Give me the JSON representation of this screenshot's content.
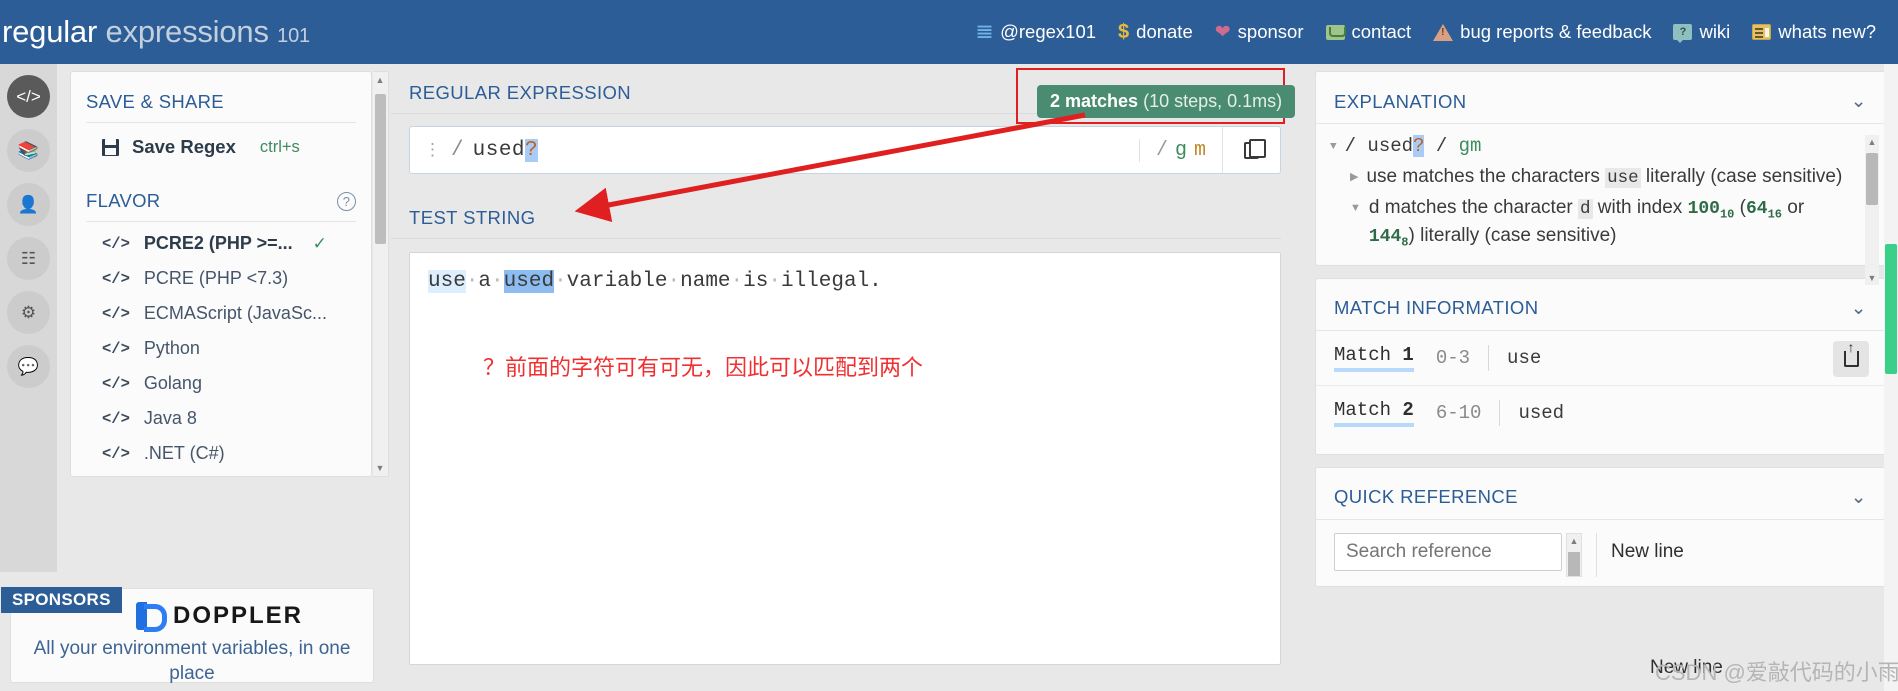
{
  "navbar": {
    "logo": {
      "part1": "regular",
      "part2": "expressions",
      "part3": "101"
    },
    "links": [
      {
        "label": "@regex101",
        "icon": "twitter-icon"
      },
      {
        "label": "donate",
        "icon": "dollar-icon"
      },
      {
        "label": "sponsor",
        "icon": "heart-icon"
      },
      {
        "label": "contact",
        "icon": "envelope-icon"
      },
      {
        "label": "bug reports & feedback",
        "icon": "warning-icon"
      },
      {
        "label": "wiki",
        "icon": "question-bubble-icon"
      },
      {
        "label": "whats new?",
        "icon": "newspaper-icon"
      }
    ]
  },
  "rail": {
    "items": [
      {
        "name": "code-icon",
        "glyph": "</>",
        "active": true
      },
      {
        "name": "library-icon",
        "glyph": "☰",
        "active": false
      },
      {
        "name": "account-icon",
        "glyph": "●",
        "active": false
      },
      {
        "name": "community-icon",
        "glyph": "⚙",
        "active": false
      },
      {
        "name": "settings-icon",
        "glyph": "⚙",
        "active": false
      },
      {
        "name": "chat-icon",
        "glyph": "▣",
        "active": false
      }
    ]
  },
  "sidebar": {
    "save_share_title": "SAVE & SHARE",
    "save_regex_label": "Save Regex",
    "save_regex_shortcut": "ctrl+s",
    "flavor_title": "FLAVOR",
    "help_glyph": "?",
    "flavors": [
      {
        "label": "PCRE2 (PHP >=...",
        "selected": true
      },
      {
        "label": "PCRE (PHP <7.3)",
        "selected": false
      },
      {
        "label": "ECMAScript (JavaSc...",
        "selected": false
      },
      {
        "label": "Python",
        "selected": false
      },
      {
        "label": "Golang",
        "selected": false
      },
      {
        "label": "Java 8",
        "selected": false
      },
      {
        "label": ".NET (C#)",
        "selected": false
      }
    ]
  },
  "sponsors": {
    "tag": "SPONSORS",
    "brand": "DOPPLER",
    "tagline": "All your environment variables, in one place"
  },
  "center": {
    "regex_label": "REGULAR EXPRESSION",
    "regex_prefix_slash": "/",
    "regex_body": "used",
    "regex_quantifier": "?",
    "flag_slash": "/",
    "flag_g": "g",
    "flag_m": "m",
    "test_label": "TEST STRING",
    "test_string": {
      "match1": "use",
      "mid": "a",
      "match2": "used",
      "rest": [
        "variable",
        "name",
        "is",
        "illegal."
      ]
    },
    "annotation_cn": "？前面的字符可有可无，因此可以匹配到两个"
  },
  "match_badge": {
    "count_text": "2 matches",
    "detail_text": "(10 steps, 0.1ms)"
  },
  "explanation": {
    "title": "EXPLANATION",
    "pattern_slash": "/",
    "pattern_body": "used",
    "pattern_quant": "?",
    "pattern_flags": "gm",
    "rows": [
      {
        "pre": "use matches the characters ",
        "literal": "use",
        "post": " literally (case sensitive)"
      },
      {
        "pre": "d matches the character ",
        "literal": "d",
        "post": " with index ",
        "dec": "100",
        "dec_sub": "10",
        "hex": "64",
        "hex_sub": "16",
        "oct": "144",
        "oct_sub": "8",
        "tail": ") literally (case sensitive)"
      }
    ]
  },
  "match_information": {
    "title": "MATCH INFORMATION",
    "matches": [
      {
        "label": "Match",
        "index": "1",
        "range": "0-3",
        "value": "use"
      },
      {
        "label": "Match",
        "index": "2",
        "range": "6-10",
        "value": "used"
      }
    ]
  },
  "quick_reference": {
    "title": "QUICK REFERENCE",
    "search_placeholder": "Search reference",
    "first_item": "New line"
  },
  "watermark": {
    "text": "CSDN @爱敲代码的小雨"
  },
  "colors": {
    "navbar_blue": "#2c5d96",
    "match_green": "#4a8c72",
    "annotation_red": "#e02020",
    "match1_highlight": "#ddeeff",
    "match2_highlight": "#8dbdf0",
    "quantifier_highlight": "#a8ccf5",
    "scrollbar_green": "#3ad08a"
  }
}
